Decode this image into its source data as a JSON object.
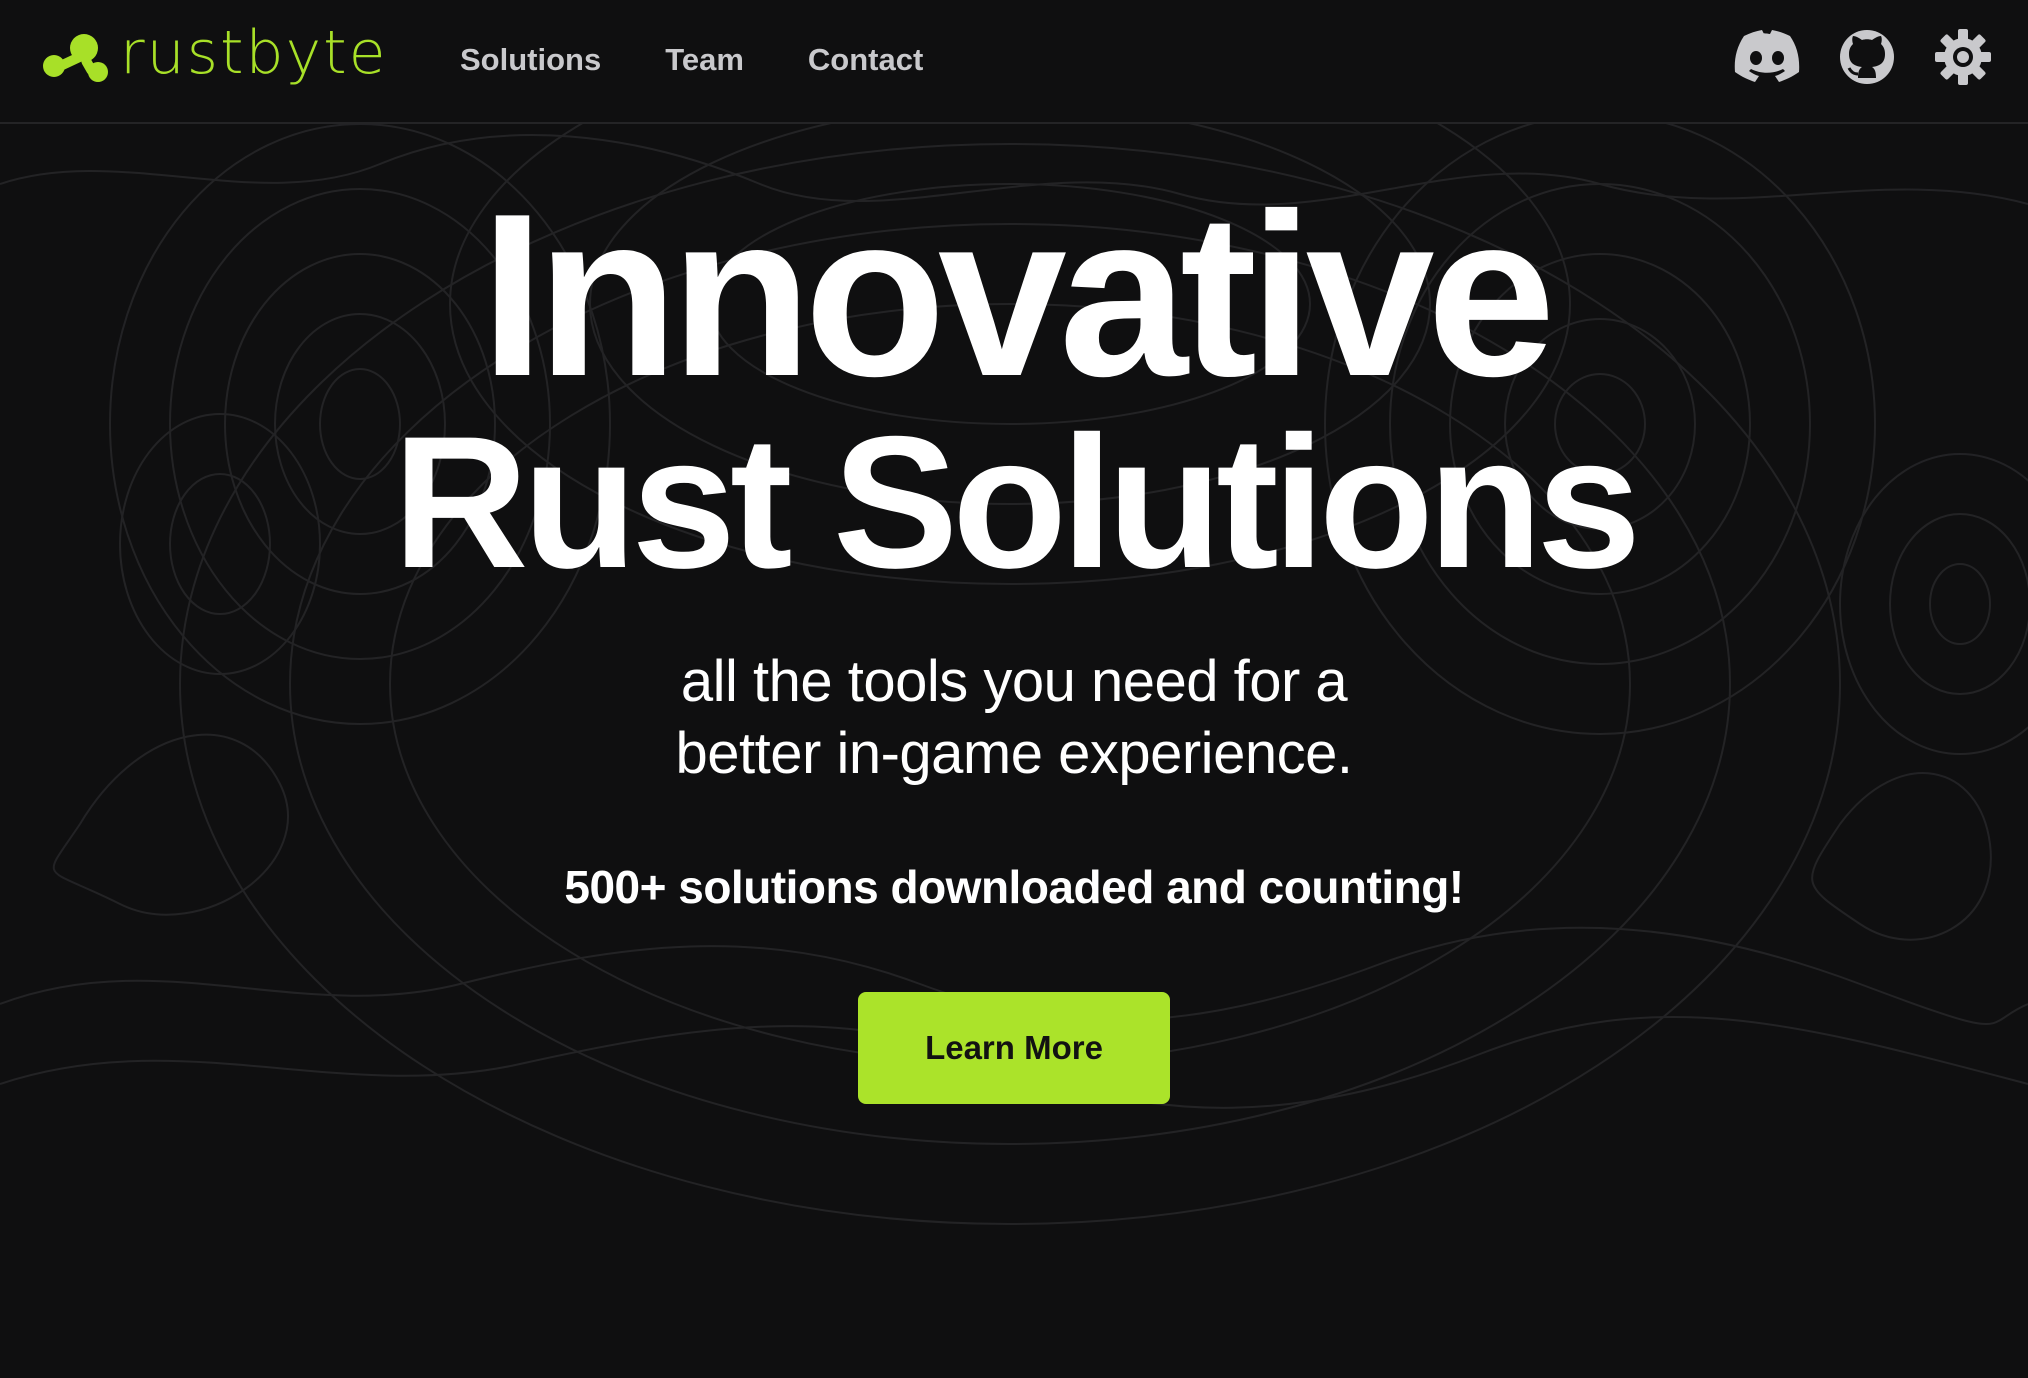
{
  "brand": {
    "name": "rustbyte",
    "accent_color": "#abe32a",
    "logo_icon": "molecule-logo-icon"
  },
  "nav": {
    "links": [
      {
        "label": "Solutions"
      },
      {
        "label": "Team"
      },
      {
        "label": "Contact"
      }
    ],
    "icons": [
      {
        "name": "discord-icon"
      },
      {
        "name": "github-icon"
      },
      {
        "name": "gear-icon"
      }
    ]
  },
  "hero": {
    "title_line1": "Innovative",
    "title_line2": "Rust Solutions",
    "subtitle_line1": "all the tools you need for a",
    "subtitle_line2": "better in-game experience.",
    "stat": "500+ solutions downloaded and counting!",
    "cta_label": "Learn More"
  },
  "colors": {
    "background": "#0f0f10",
    "nav_text": "#c9c9cc",
    "hero_text": "#ffffff",
    "button_text": "#121212"
  }
}
